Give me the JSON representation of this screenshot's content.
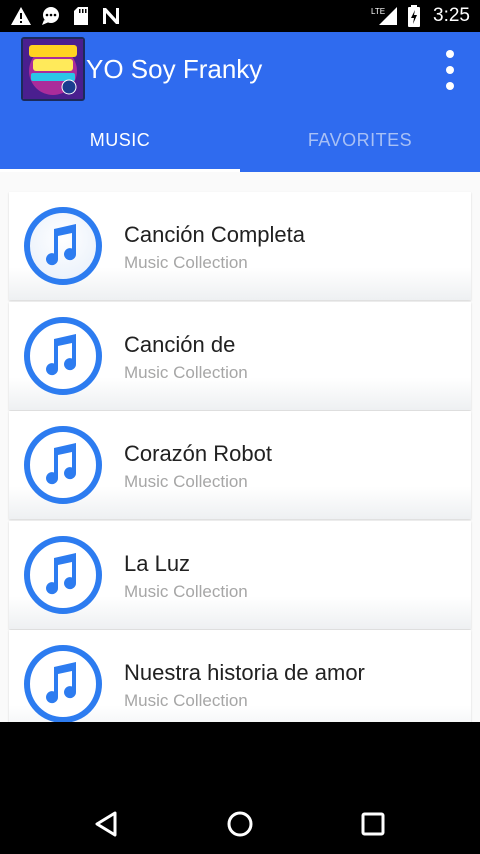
{
  "status_bar": {
    "time": "3:25",
    "network_label": "LTE",
    "icons": [
      "warning-icon",
      "chat-icon",
      "sd-card-icon",
      "n-icon",
      "lte-signal-icon",
      "battery-icon"
    ]
  },
  "app_bar": {
    "title": "YO Soy Franky",
    "logo_icon": "app-logo-icon",
    "overflow_icon": "more-vert-icon",
    "color": "#2f6bef"
  },
  "tabs": [
    {
      "label": "MUSIC",
      "active": true
    },
    {
      "label": "FAVORITES",
      "active": false
    }
  ],
  "songs": [
    {
      "title": "Canción Completa",
      "subtitle": "Music Collection",
      "icon": "music-note-icon"
    },
    {
      "title": "Canción de",
      "subtitle": "Music Collection",
      "icon": "music-note-icon"
    },
    {
      "title": "Corazón Robot",
      "subtitle": "Music Collection",
      "icon": "music-note-icon"
    },
    {
      "title": "La Luz",
      "subtitle": "Music Collection",
      "icon": "music-note-icon"
    },
    {
      "title": "Nuestra historia de amor",
      "subtitle": "Music Collection",
      "icon": "music-note-icon"
    }
  ],
  "nav_bar": {
    "back_icon": "back-icon",
    "home_icon": "home-icon",
    "recents_icon": "recents-icon"
  },
  "colors": {
    "accent": "#2f6bef",
    "icon_ring": "#2d7cf0"
  }
}
